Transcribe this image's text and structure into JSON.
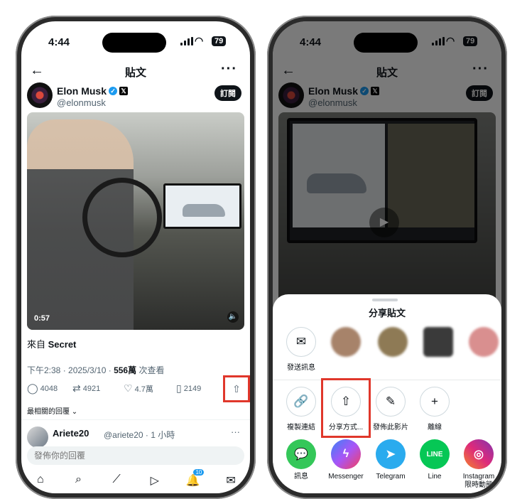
{
  "status": {
    "time": "4:44",
    "battery": "79"
  },
  "nav": {
    "back": "←",
    "title": "貼文",
    "more": "···"
  },
  "author": {
    "name": "Elon Musk",
    "handle": "@elonmusk",
    "subscribe": "訂閱",
    "verified_glyph": "✓",
    "x_glyph": "𝕏"
  },
  "video": {
    "duration": "0:57",
    "mute_glyph": "🔈",
    "play_glyph": "▶"
  },
  "source": {
    "prefix": "來自",
    "name": "Secret"
  },
  "meta": {
    "time": "下午2:38 · 2025/3/10 · ",
    "views": "556萬",
    "views_suffix": " 次查看"
  },
  "actions": [
    {
      "icon": "comment-icon",
      "glyph": "◯",
      "count": "4048"
    },
    {
      "icon": "retweet-icon",
      "glyph": "⇄",
      "count": "4921"
    },
    {
      "icon": "like-icon",
      "glyph": "♡",
      "count": "4.7萬"
    },
    {
      "icon": "bookmark-icon",
      "glyph": "▯",
      "count": "2149"
    }
  ],
  "share_glyph": "⇧",
  "replies": {
    "label": "最相關的回覆 ⌄"
  },
  "reply": {
    "name": "Ariete20",
    "handle": "@ariete20 · 1 小時",
    "more": "···"
  },
  "reply_box": {
    "placeholder": "發佈你的回覆"
  },
  "tabbar": [
    {
      "icon": "home-icon",
      "glyph": "⌂"
    },
    {
      "icon": "search-icon",
      "glyph": "⌕"
    },
    {
      "icon": "grok-icon",
      "glyph": "⟋"
    },
    {
      "icon": "video-icon",
      "glyph": "▷"
    },
    {
      "icon": "notifications-icon",
      "glyph": "🔔",
      "badge": "10"
    },
    {
      "icon": "messages-icon",
      "glyph": "✉"
    }
  ],
  "sheet": {
    "title": "分享貼文",
    "message": {
      "glyph": "✉",
      "label": "發送訊息"
    },
    "actions": [
      {
        "icon": "link-icon",
        "glyph": "🔗",
        "label": "複製連結"
      },
      {
        "icon": "share-via-icon",
        "glyph": "⇧",
        "label": "分享方式..."
      },
      {
        "icon": "post-video-icon",
        "glyph": "✎",
        "label": "發佈此影片"
      },
      {
        "icon": "more-icon",
        "glyph": "+",
        "label": "離線"
      }
    ],
    "apps": [
      {
        "icon": "messages-app-icon",
        "glyph": "💬",
        "label": "訊息",
        "color": "#34c759"
      },
      {
        "icon": "messenger-icon",
        "glyph": "ϟ",
        "label": "Messenger",
        "color": "#7a5cff"
      },
      {
        "icon": "telegram-icon",
        "glyph": "➤",
        "label": "Telegram",
        "color": "#2aabee"
      },
      {
        "icon": "line-icon",
        "glyph": "LINE",
        "label": "Line",
        "color": "#06c755"
      },
      {
        "icon": "instagram-icon",
        "glyph": "◎",
        "label": "Instagram\n限時動態",
        "color": "#d6249f"
      }
    ]
  }
}
